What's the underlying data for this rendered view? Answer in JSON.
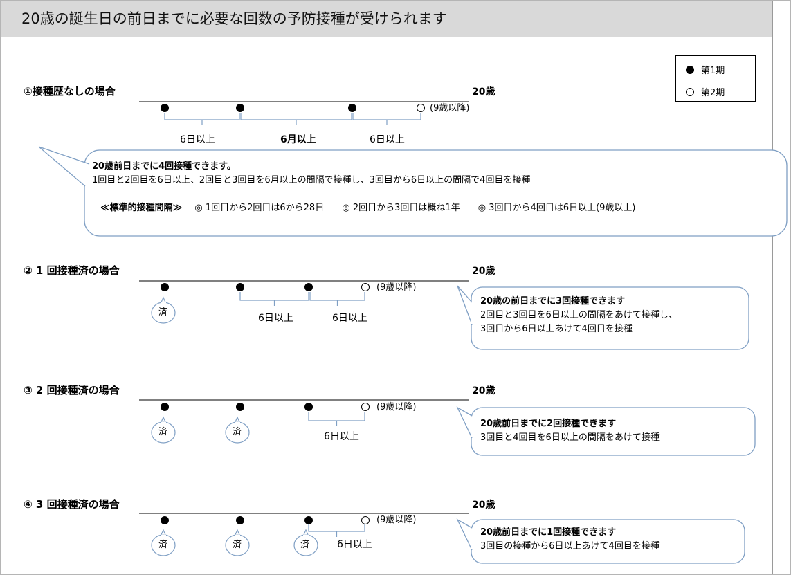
{
  "title": "20歳の誕生日の前日までに必要な回数の予防接種が受けられます",
  "legend": {
    "items": [
      {
        "label": "第1期",
        "symbol": "filled-circle"
      },
      {
        "label": "第2期",
        "symbol": "open-circle"
      }
    ]
  },
  "colors": {
    "title_bar": "#d9d9d9",
    "callout_border": "#7f9fc4",
    "bracket": "#7f9fc4",
    "dot": "#000000"
  },
  "sections": [
    {
      "title": "①接種歴なしの場合",
      "age_label": "20歳",
      "note": "(9歳以降)",
      "intervals": [
        "6日以上",
        "6月以上",
        "6日以上"
      ],
      "callout": {
        "headline": "20歳前日までに4回接種できます。",
        "lines": [
          "1回目と2回目を6日以上、2回目と3回目を6月以上の間隔で接種し、3回目から6日以上の間隔で4回目を接種"
        ],
        "standard_label": "≪標準的接種間隔≫",
        "standard_items": [
          "◎ 1回目から2回目は6から28日",
          "◎ 2回目から3回目は概ね1年",
          "◎ 3回目から4回目は6日以上(9歳以上)"
        ]
      }
    },
    {
      "title": "② 1 回接種済の場合",
      "age_label": "20歳",
      "note": "(9歳以降)",
      "intervals": [
        "6日以上",
        "6日以上"
      ],
      "done_label": "済",
      "callout": {
        "headline": "20歳の前日までに3回接種できます",
        "lines": [
          "2回目と3回目を6日以上の間隔をあけて接種し、",
          "3回目から6日以上あけて4回目を接種"
        ]
      }
    },
    {
      "title": "③ 2 回接種済の場合",
      "age_label": "20歳",
      "note": "(9歳以降)",
      "intervals": [
        "6日以上"
      ],
      "done_label": "済",
      "callout": {
        "headline": "20歳前日までに2回接種できます",
        "lines": [
          "3回目と4回目を6日以上の間隔をあけて接種"
        ]
      }
    },
    {
      "title": "④ 3 回接種済の場合",
      "age_label": "20歳",
      "note": "(9歳以降)",
      "intervals": [
        "6日以上"
      ],
      "done_label": "済",
      "callout": {
        "headline": "20歳前日までに1回接種できます",
        "lines": [
          "3回目の接種から6日以上あけて4回目を接種"
        ]
      }
    }
  ]
}
